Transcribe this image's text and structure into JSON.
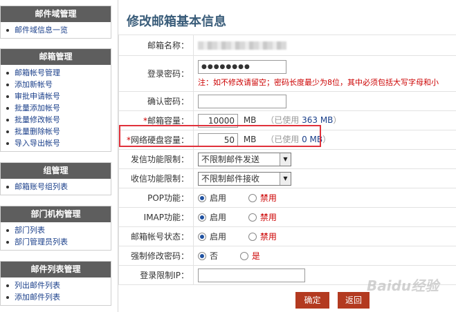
{
  "sidebar": [
    {
      "title": "邮件域管理",
      "items": [
        "邮件域信息一览"
      ]
    },
    {
      "title": "邮箱管理",
      "items": [
        "邮箱帐号管理",
        "添加新帐号",
        "审批申请帐号",
        "批量添加帐号",
        "批量修改帐号",
        "批量删除帐号",
        "导入导出帐号"
      ]
    },
    {
      "title": "组管理",
      "items": [
        "邮箱账号组列表"
      ]
    },
    {
      "title": "部门机构管理",
      "items": [
        "部门列表",
        "部门管理员列表"
      ]
    },
    {
      "title": "邮件列表管理",
      "items": [
        "列出邮件列表",
        "添加邮件列表"
      ]
    }
  ],
  "main": {
    "title": "修改邮箱基本信息",
    "fields": {
      "mailbox_name": {
        "label": "邮箱名称："
      },
      "password": {
        "label": "登录密码：",
        "value": "●●●●●●●●",
        "note": "注：如不修改请留空；密码长度最少为8位，其中必须包括大写字母和小"
      },
      "confirm_password": {
        "label": "确认密码：",
        "value": ""
      },
      "mailbox_quota": {
        "required_mark": "*",
        "label": "邮箱容量：",
        "value": "10000",
        "unit": "MB",
        "used_prefix": "（已使用",
        "used_value": "363 MB",
        "used_suffix": "）"
      },
      "disk_quota": {
        "required_mark": "*",
        "label": "网络硬盘容量：",
        "value": "50",
        "unit": "MB",
        "used_prefix": "（已使用",
        "used_value": "0 MB",
        "used_suffix": "）"
      },
      "send_limit": {
        "label": "发信功能限制：",
        "selected": "不限制邮件发送"
      },
      "receive_limit": {
        "label": "收信功能限制：",
        "selected": "不限制邮件接收"
      },
      "pop": {
        "label": "POP功能：",
        "on_label": "启用",
        "off_label": "禁用"
      },
      "imap": {
        "label": "IMAP功能：",
        "on_label": "启用",
        "off_label": "禁用"
      },
      "account_status": {
        "label": "邮箱帐号状态：",
        "on_label": "启用",
        "off_label": "禁用"
      },
      "force_change_pwd": {
        "label": "强制修改密码：",
        "on_label": "否",
        "off_label": "是"
      },
      "login_ip": {
        "label": "登录限制IP：",
        "value": ""
      }
    },
    "buttons": {
      "confirm": "确定",
      "back": "返回"
    }
  },
  "watermark": "Baidu经验",
  "colors": {
    "sidebar_header": "#5e5e5e",
    "title": "#3a5d7a",
    "button": "#b33a20",
    "highlight": "#e0303a",
    "link": "#1a3f8a"
  }
}
